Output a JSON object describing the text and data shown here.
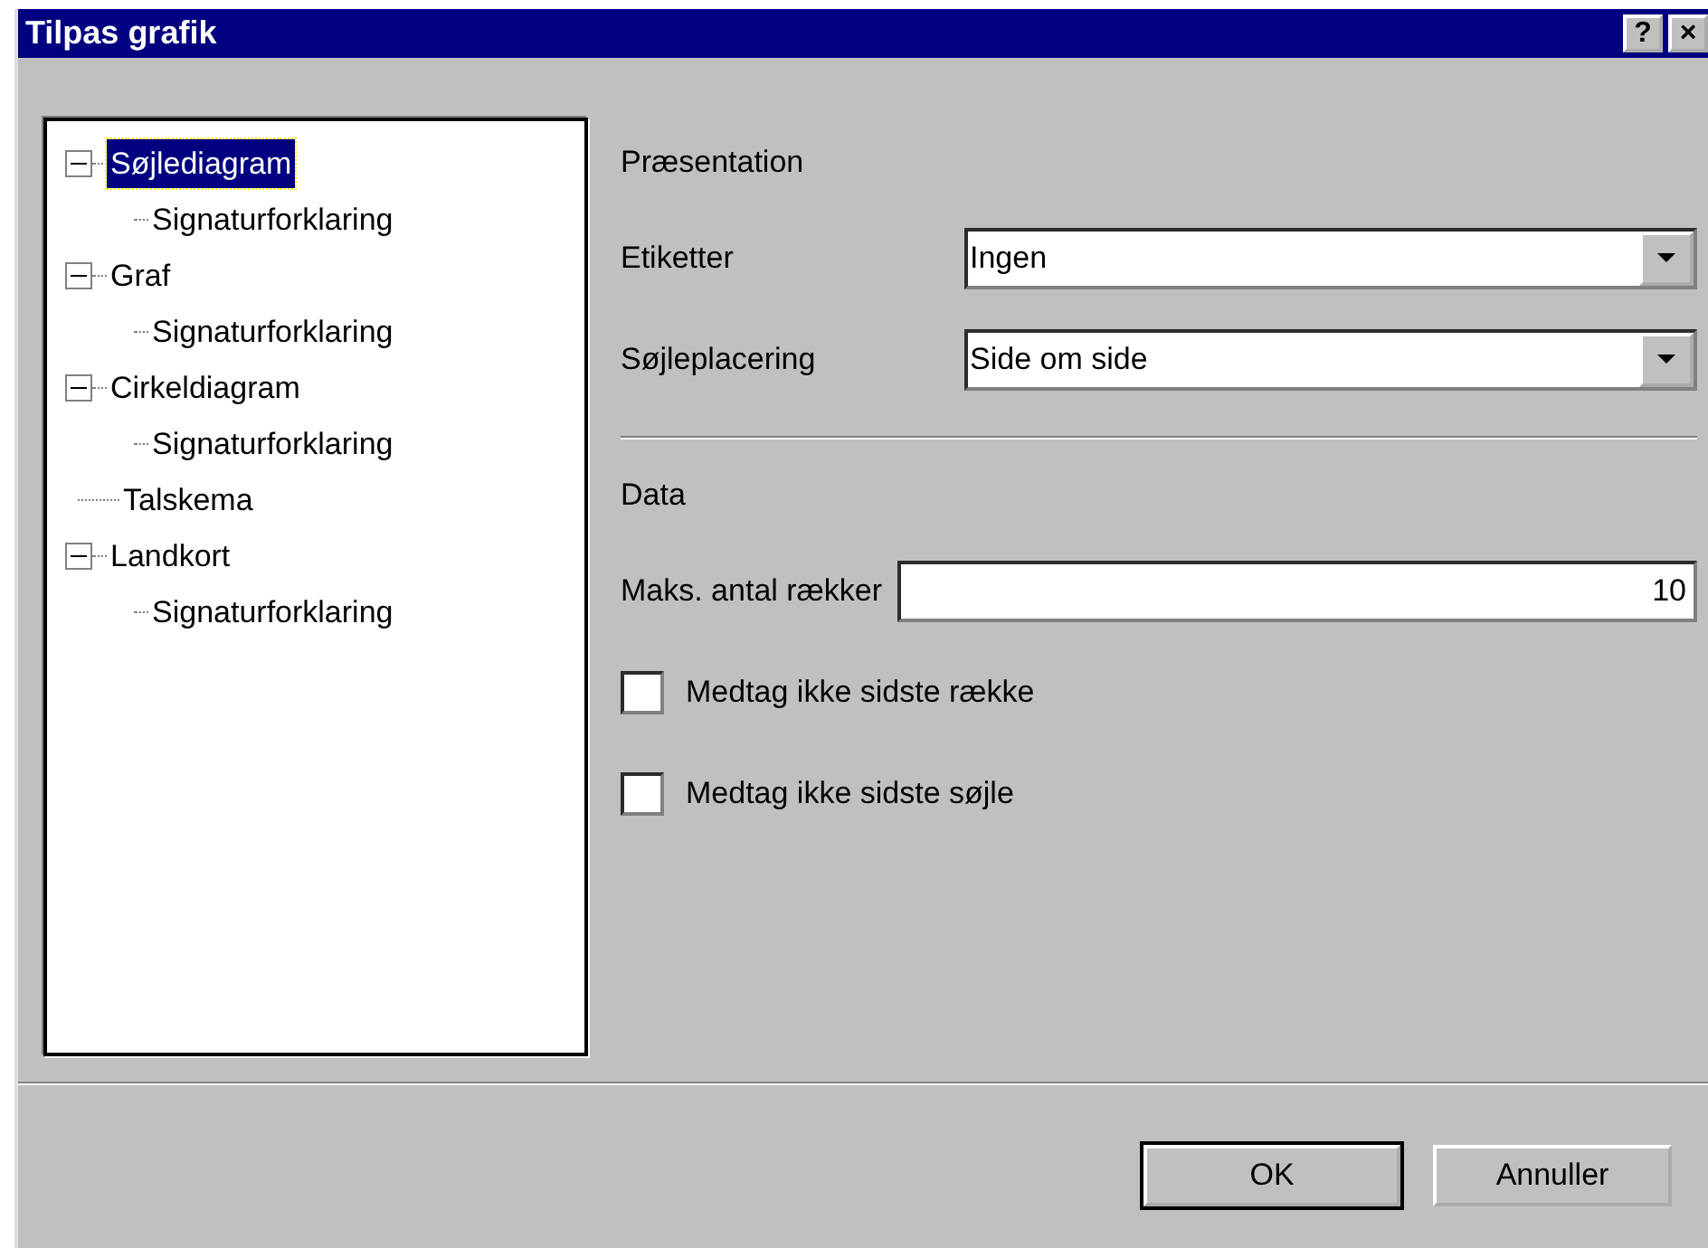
{
  "window": {
    "title": "Tilpas grafik",
    "title_buttons": [
      "?",
      "×"
    ]
  },
  "tree": [
    {
      "label": "Søjlediagram",
      "selected": true,
      "expanded": true,
      "children": [
        {
          "label": "Signaturforklaring",
          "selected": false
        }
      ]
    },
    {
      "label": "Graf",
      "selected": false,
      "expanded": true,
      "children": [
        {
          "label": "Signaturforklaring",
          "selected": false
        }
      ]
    },
    {
      "label": "Cirkeldiagram",
      "selected": false,
      "expanded": true,
      "children": [
        {
          "label": "Signaturforklaring",
          "selected": false
        }
      ]
    },
    {
      "label": "Talskema",
      "selected": false
    },
    {
      "label": "Landkort",
      "selected": false,
      "expanded": true,
      "children": [
        {
          "label": "Signaturforklaring",
          "selected": false
        }
      ]
    }
  ],
  "sections": [
    {
      "heading": "Præsentation",
      "fields": [
        {
          "kind": "dropdown",
          "label": "Etiketter",
          "value": "Ingen"
        },
        {
          "kind": "dropdown",
          "label": "Søjleplacering",
          "value": "Side om side"
        }
      ]
    },
    {
      "heading": "Data",
      "fields": [
        {
          "kind": "number",
          "label": "Maks. antal rækker",
          "value": "10"
        },
        {
          "kind": "checkbox",
          "label": "Medtag ikke sidste række",
          "checked": false
        },
        {
          "kind": "checkbox",
          "label": "Medtag ikke sidste søjle",
          "checked": false
        }
      ]
    }
  ],
  "buttons": [
    {
      "label": "OK",
      "default": true
    },
    {
      "label": "Annuller",
      "default": false
    }
  ]
}
